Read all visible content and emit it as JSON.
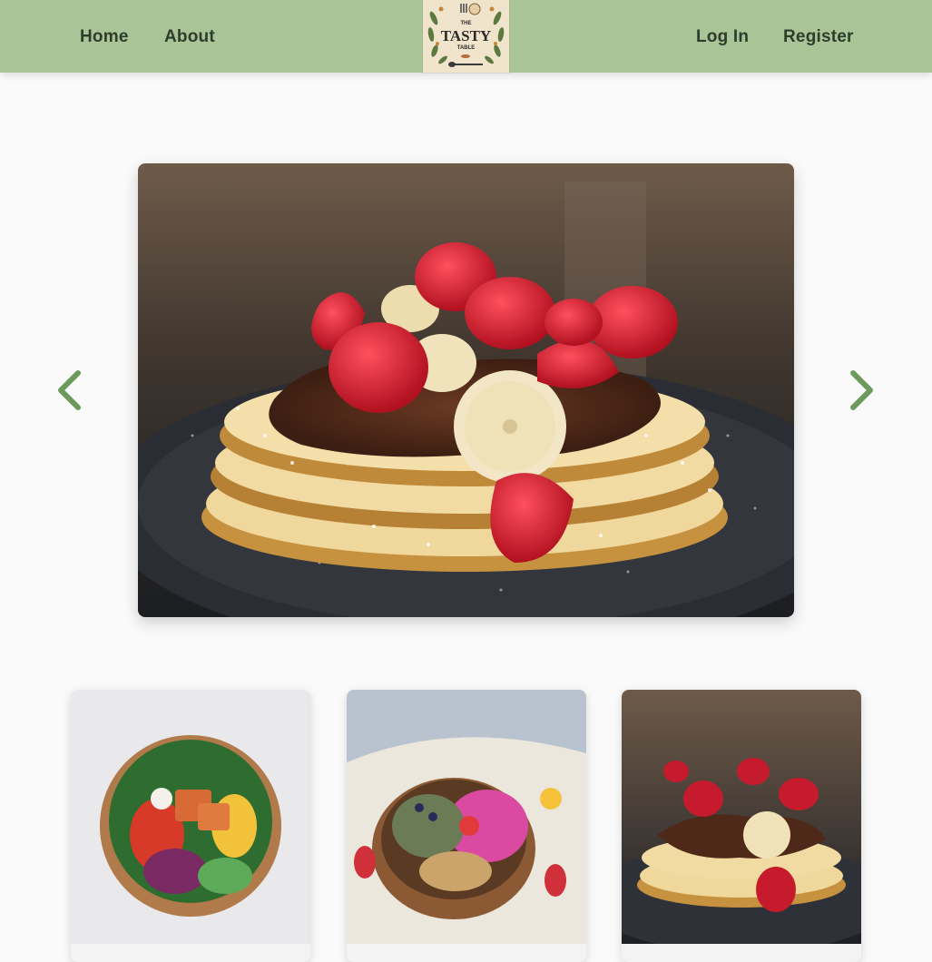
{
  "nav": {
    "home_label": "Home",
    "about_label": "About",
    "login_label": "Log In",
    "register_label": "Register",
    "logo_text": {
      "the": "THE",
      "tasty": "TASTY",
      "table": "TABLE"
    }
  },
  "carousel": {
    "prev_icon": "chevron-left-icon",
    "next_icon": "chevron-right-icon",
    "current_image": "pancakes-with-strawberries-banana-and-chocolate"
  },
  "cards": [
    {
      "image": "salmon-poke-bowl"
    },
    {
      "image": "smoothie-bowl-with-berries-and-granola"
    },
    {
      "image": "pancakes-with-strawberries-banana-and-chocolate"
    }
  ],
  "colors": {
    "navbar": "#a9c597",
    "accent": "#6c9a5c",
    "nav_text": "#2e3d2b",
    "logo_bg": "#f1e4cc",
    "page_bg": "#fafafa"
  }
}
